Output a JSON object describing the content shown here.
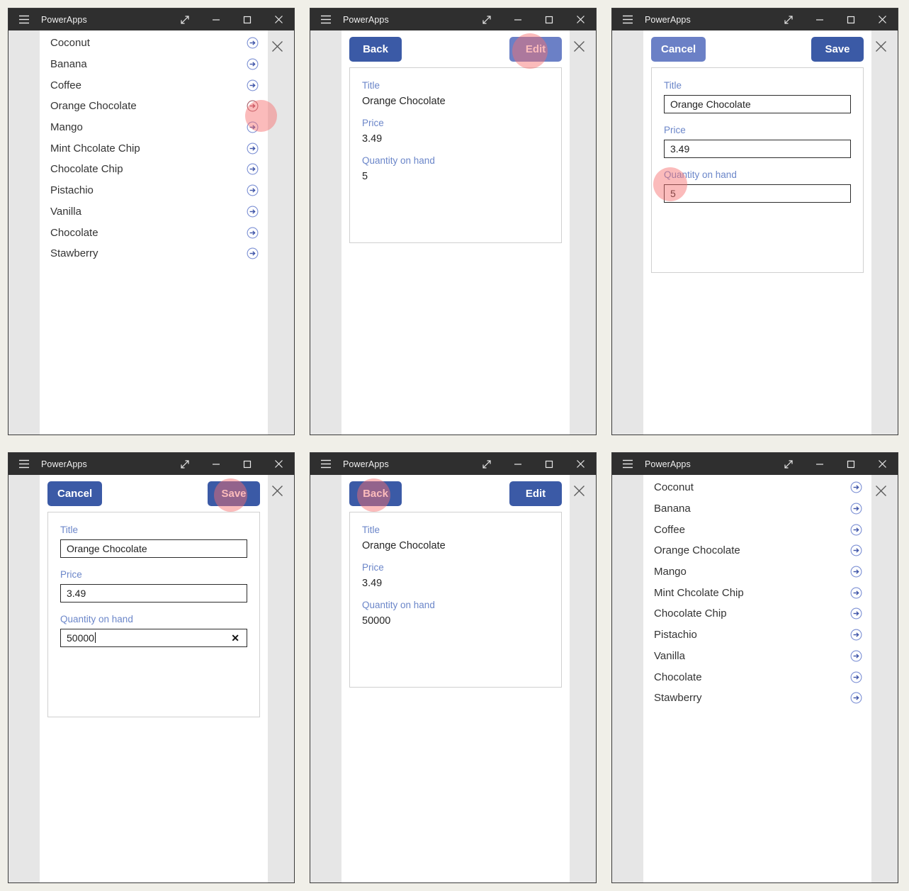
{
  "window": {
    "title": "PowerApps",
    "icons": {
      "menu": "hamburger-icon",
      "expand": "expand-diagonal-icon",
      "minimize": "minimize-icon",
      "maximize": "maximize-icon",
      "close": "close-icon",
      "panel_close": "close-icon",
      "row_arrow": "arrow-circle-right-icon",
      "field_clear": "clear-x-icon"
    }
  },
  "colors": {
    "primary_button": "#3b5aa6",
    "secondary_button": "#6b80c6",
    "field_label": "#6b86c9",
    "titlebar": "#2f2f2f",
    "app_background": "#e6e6e6",
    "page_background": "#f0efe8",
    "highlight": "rgba(247,110,110,0.47)"
  },
  "list_screen": {
    "items": [
      {
        "label": "Coconut"
      },
      {
        "label": "Banana"
      },
      {
        "label": "Coffee"
      },
      {
        "label": "Orange Chocolate"
      },
      {
        "label": "Mango"
      },
      {
        "label": "Mint Chcolate Chip"
      },
      {
        "label": "Chocolate Chip"
      },
      {
        "label": "Pistachio"
      },
      {
        "label": "Vanilla"
      },
      {
        "label": "Chocolate"
      },
      {
        "label": "Stawberry"
      }
    ]
  },
  "panels": [
    {
      "id": "panel-1-list-click-arrow",
      "screen": "list",
      "highlight": {
        "target": "row-arrow-orange-chocolate"
      }
    },
    {
      "id": "panel-2-detail-click-edit",
      "screen": "detail",
      "commands": {
        "left": "Back",
        "right": "Edit"
      },
      "fields": [
        {
          "label": "Title",
          "value": "Orange Chocolate"
        },
        {
          "label": "Price",
          "value": "3.49"
        },
        {
          "label": "Quantity on hand",
          "value": "5"
        }
      ],
      "highlight": {
        "target": "edit-button"
      }
    },
    {
      "id": "panel-3-edit-click-quantity",
      "screen": "edit",
      "commands": {
        "left": "Cancel",
        "right": "Save"
      },
      "fields": [
        {
          "label": "Title",
          "value": "Orange Chocolate"
        },
        {
          "label": "Price",
          "value": "3.49"
        },
        {
          "label": "Quantity on hand",
          "value": "5"
        }
      ],
      "highlight": {
        "target": "quantity-input"
      }
    },
    {
      "id": "panel-4-edit-typed-click-save",
      "screen": "edit",
      "commands": {
        "left": "Cancel",
        "right": "Save"
      },
      "fields": [
        {
          "label": "Title",
          "value": "Orange Chocolate"
        },
        {
          "label": "Price",
          "value": "3.49"
        },
        {
          "label": "Quantity on hand",
          "value": "50000"
        }
      ],
      "highlight": {
        "target": "save-button"
      }
    },
    {
      "id": "panel-5-detail-click-back",
      "screen": "detail",
      "commands": {
        "left": "Back",
        "right": "Edit"
      },
      "fields": [
        {
          "label": "Title",
          "value": "Orange Chocolate"
        },
        {
          "label": "Price",
          "value": "3.49"
        },
        {
          "label": "Quantity on hand",
          "value": "50000"
        }
      ],
      "highlight": {
        "target": "back-button"
      }
    },
    {
      "id": "panel-6-list-final",
      "screen": "list",
      "highlight": null
    }
  ]
}
